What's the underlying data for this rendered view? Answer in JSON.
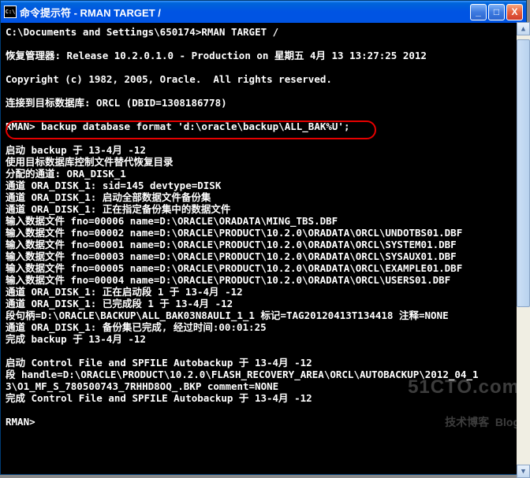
{
  "window": {
    "title": "命令提示符 - RMAN TARGET /",
    "icon_text": "C:\\"
  },
  "buttons": {
    "minimize": "_",
    "maximize": "□",
    "close": "X"
  },
  "terminal": {
    "line1": "C:\\Documents and Settings\\650174>RMAN TARGET /",
    "line2": "",
    "line3": "恢复管理器: Release 10.2.0.1.0 - Production on 星期五 4月 13 13:27:25 2012",
    "line4": "",
    "line5": "Copyright (c) 1982, 2005, Oracle.  All rights reserved.",
    "line6": "",
    "line7": "连接到目标数据库: ORCL (DBID=1308186778)",
    "line8": "",
    "line9": "RMAN> backup database format 'd:\\oracle\\backup\\ALL_BAK%U';",
    "line10": "",
    "line11": "启动 backup 于 13-4月 -12",
    "line12": "使用目标数据库控制文件替代恢复目录",
    "line13": "分配的通道: ORA_DISK_1",
    "line14": "通道 ORA_DISK_1: sid=145 devtype=DISK",
    "line15": "通道 ORA_DISK_1: 启动全部数据文件备份集",
    "line16": "通道 ORA_DISK_1: 正在指定备份集中的数据文件",
    "line17": "输入数据文件 fno=00006 name=D:\\ORACLE\\ORADATA\\MING_TBS.DBF",
    "line18": "输入数据文件 fno=00002 name=D:\\ORACLE\\PRODUCT\\10.2.0\\ORADATA\\ORCL\\UNDOTBS01.DBF",
    "line19": "输入数据文件 fno=00001 name=D:\\ORACLE\\PRODUCT\\10.2.0\\ORADATA\\ORCL\\SYSTEM01.DBF",
    "line20": "输入数据文件 fno=00003 name=D:\\ORACLE\\PRODUCT\\10.2.0\\ORADATA\\ORCL\\SYSAUX01.DBF",
    "line21": "输入数据文件 fno=00005 name=D:\\ORACLE\\PRODUCT\\10.2.0\\ORADATA\\ORCL\\EXAMPLE01.DBF",
    "line22": "输入数据文件 fno=00004 name=D:\\ORACLE\\PRODUCT\\10.2.0\\ORADATA\\ORCL\\USERS01.DBF",
    "line23": "通道 ORA_DISK_1: 正在启动段 1 于 13-4月 -12",
    "line24": "通道 ORA_DISK_1: 已完成段 1 于 13-4月 -12",
    "line25": "段句柄=D:\\ORACLE\\BACKUP\\ALL_BAK03N8AULI_1_1 标记=TAG20120413T134418 注释=NONE",
    "line26": "通道 ORA_DISK_1: 备份集已完成, 经过时间:00:01:25",
    "line27": "完成 backup 于 13-4月 -12",
    "line28": "",
    "line29": "启动 Control File and SPFILE Autobackup 于 13-4月 -12",
    "line30": "段 handle=D:\\ORACLE\\PRODUCT\\10.2.0\\FLASH_RECOVERY_AREA\\ORCL\\AUTOBACKUP\\2012_04_1",
    "line31": "3\\O1_MF_S_780500743_7RHHD8OQ_.BKP comment=NONE",
    "line32": "完成 Control File and SPFILE Autobackup 于 13-4月 -12",
    "line33": "",
    "line34": "RMAN>"
  },
  "watermark": {
    "big": "51CTO.com",
    "small": "技术博客  Blog"
  }
}
